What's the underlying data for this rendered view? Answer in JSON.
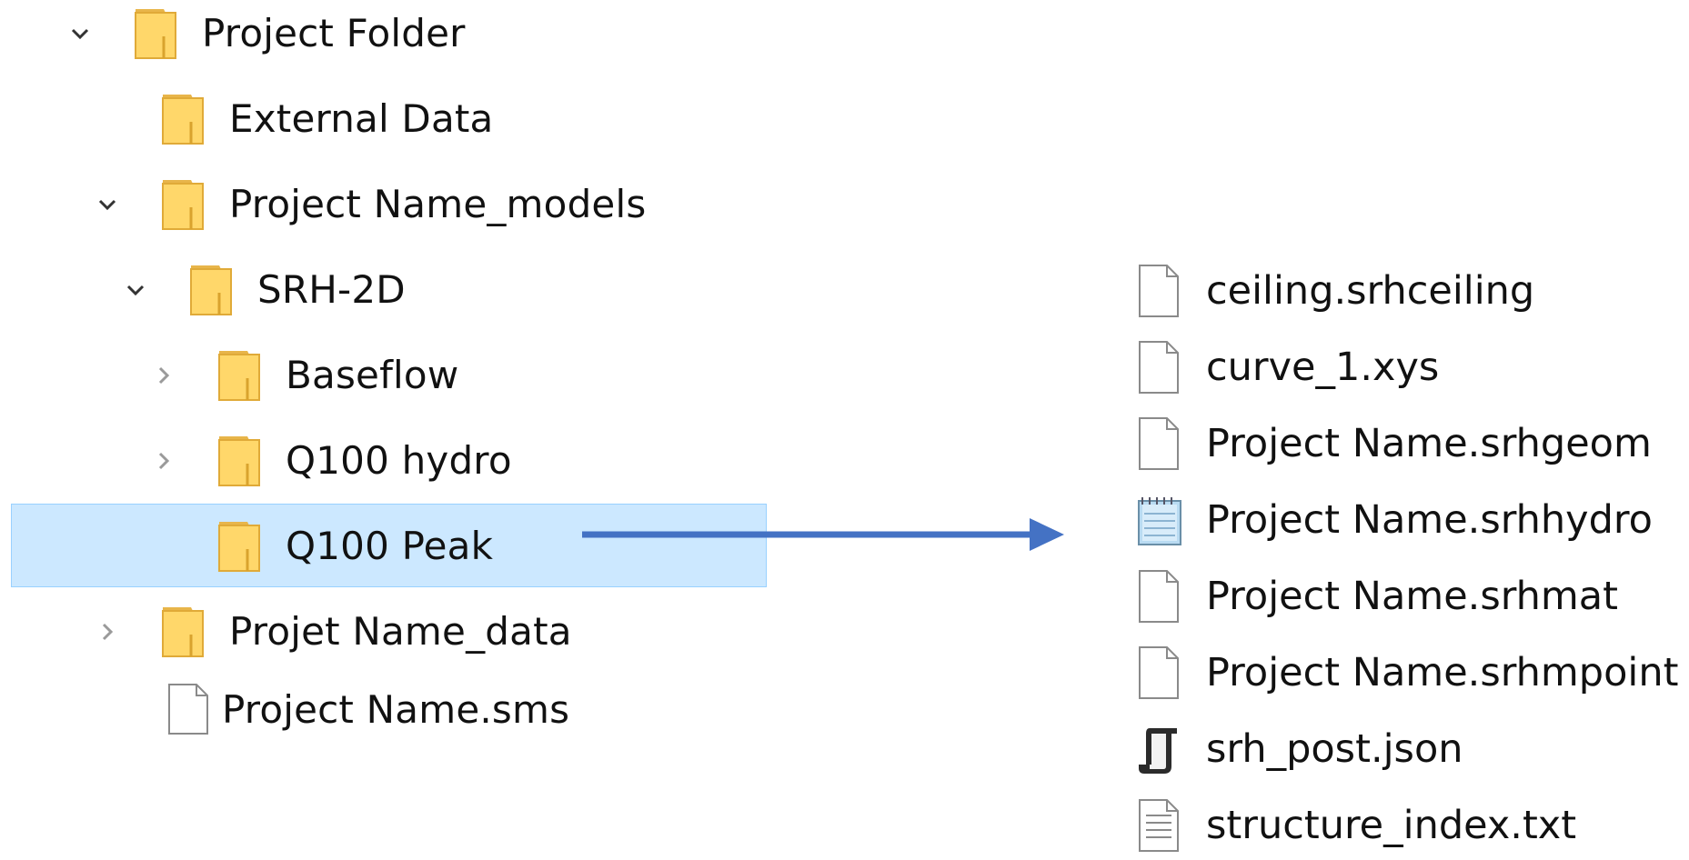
{
  "tree": {
    "items": [
      {
        "label": "Project Folder",
        "icon": "folder-icon",
        "chevron": "expanded"
      },
      {
        "label": "External Data",
        "icon": "folder-icon",
        "chevron": "none"
      },
      {
        "label": "Project Name_models",
        "icon": "folder-icon",
        "chevron": "expanded"
      },
      {
        "label": "SRH-2D",
        "icon": "folder-icon",
        "chevron": "expanded"
      },
      {
        "label": "Baseflow",
        "icon": "folder-icon",
        "chevron": "collapsed"
      },
      {
        "label": "Q100 hydro",
        "icon": "folder-icon",
        "chevron": "collapsed"
      },
      {
        "label": "Q100 Peak",
        "icon": "folder-icon",
        "chevron": "none",
        "selected": true
      },
      {
        "label": "Projet Name_data",
        "icon": "folder-icon",
        "chevron": "collapsed"
      },
      {
        "label": "Project Name.sms",
        "icon": "file-icon",
        "chevron": "none"
      }
    ]
  },
  "files": {
    "items": [
      {
        "label": "ceiling.srhceiling",
        "icon": "file-icon"
      },
      {
        "label": "curve_1.xys",
        "icon": "file-icon"
      },
      {
        "label": "Project Name.srhgeom",
        "icon": "file-icon"
      },
      {
        "label": "Project Name.srhhydro",
        "icon": "notepad-file-icon"
      },
      {
        "label": "Project Name.srhmat",
        "icon": "file-icon"
      },
      {
        "label": "Project Name.srhmpoint",
        "icon": "file-icon"
      },
      {
        "label": "srh_post.json",
        "icon": "script-file-icon"
      },
      {
        "label": "structure_index.txt",
        "icon": "text-file-icon"
      }
    ]
  },
  "colors": {
    "selection": "#cce8ff",
    "selection_border": "#99d1ff",
    "folder": "#ffd76a",
    "arrow": "#4472c4"
  }
}
